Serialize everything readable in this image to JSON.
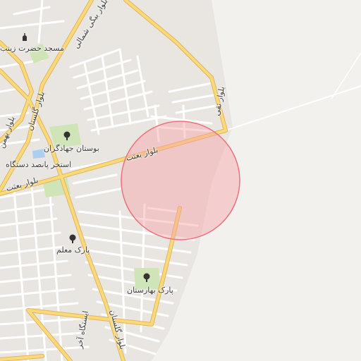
{
  "map": {
    "type": "street-map",
    "colors": {
      "land": "#f3f1ee",
      "urban": "#e9e6e2",
      "street": "#ffffff",
      "street_outline": "#d6d3cf",
      "arterial": "#f9d97c",
      "arterial_outline": "#e3b556",
      "park": "#cfe5b8",
      "water": "#a9d1ef",
      "radius_fill": "#f6a1a7",
      "radius_stroke": "#e9747e"
    },
    "radius_circle": {
      "description_shape": "circle",
      "opacity": 0.45
    }
  },
  "labels": {
    "road_baat_upper": "بلوار بعثت",
    "road_baat_lower": "بلوار بعثت",
    "road_taghi": "بلوار تقی",
    "road_golestan_upper": "بلوار گلستان",
    "road_golestan_lower": "بلوار گلستان",
    "road_bahman": "بلوار بهمن",
    "road_north_beigi": "بلوار بیگی شمالی",
    "road_station": "ایستگاه آخر",
    "mosque": "مسجد حضرت زینب",
    "park_jahadgaran": "بوستان جهادگران",
    "pool": "استخر پانصد دستگاه",
    "park_moallem": "پارک معلم",
    "park_baharestan": "پارک بهارستان"
  },
  "icons": {
    "mosque": "mosque-icon",
    "park_jahadgaran": "tree-icon",
    "park_moallem": "tree-icon",
    "park_baharestan": "tree-icon"
  }
}
